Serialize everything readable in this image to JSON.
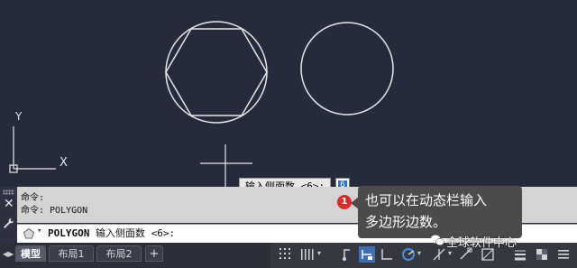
{
  "drawing": {
    "axis_x_label": "X",
    "axis_y_label": "Y"
  },
  "dynamic_input": {
    "prompt": "输入侧面数 <6>:",
    "value": "6"
  },
  "callout": {
    "badge": "1",
    "line1": "也可以在动态栏输入",
    "line2": "多边形边数。"
  },
  "command_window": {
    "history": [
      "命令:",
      "命令:   POLYGON"
    ],
    "current_command": "POLYGON",
    "current_prompt": "输入侧面数 <6>:"
  },
  "tabs": [
    {
      "label": "模型",
      "active": true
    },
    {
      "label": "布局1",
      "active": false
    },
    {
      "label": "布局2",
      "active": false
    }
  ],
  "tab_add_label": "+",
  "watermark": "全球软件中心",
  "colors": {
    "background": "#252b3c",
    "geometry": "#e6e6e6",
    "badge": "#e02a2a",
    "callout": "#4b4b4b"
  }
}
